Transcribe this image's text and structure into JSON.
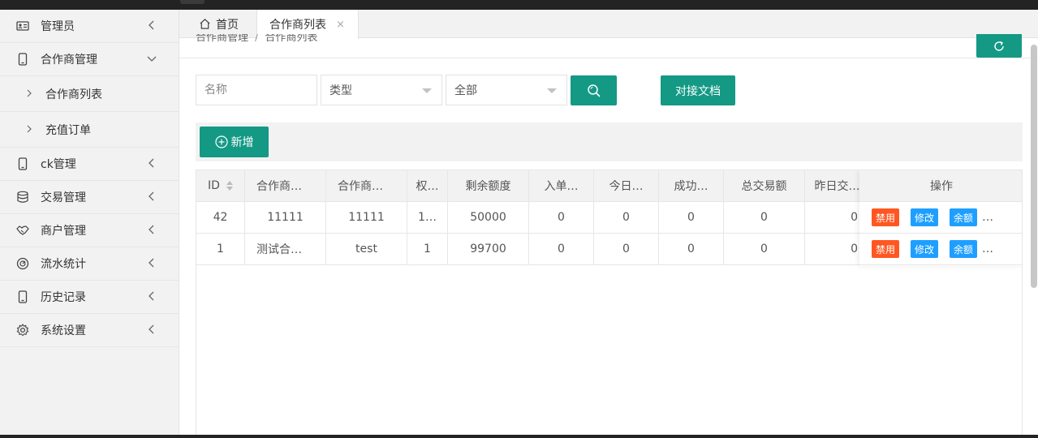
{
  "sidebar": {
    "items": [
      {
        "label": "管理员",
        "icon": "id-card-icon"
      },
      {
        "label": "合作商管理",
        "icon": "phone-icon",
        "expanded": true
      },
      {
        "label": "ck管理",
        "icon": "phone-icon"
      },
      {
        "label": "交易管理",
        "icon": "database-icon"
      },
      {
        "label": "商户管理",
        "icon": "handshake-icon"
      },
      {
        "label": "流水统计",
        "icon": "dashboard-icon"
      },
      {
        "label": "历史记录",
        "icon": "phone-icon"
      },
      {
        "label": "系统设置",
        "icon": "gear-icon"
      }
    ],
    "subitems": [
      {
        "label": "合作商列表"
      },
      {
        "label": "充值订单"
      }
    ]
  },
  "tabs": {
    "home": "首页",
    "active": "合作商列表",
    "close": "×"
  },
  "breadcrumb": {
    "parent": "合作商管理",
    "sep": "/",
    "current": "合作商列表"
  },
  "search": {
    "name_placeholder": "名称",
    "type_value": "类型",
    "status_value": "全部",
    "doc_button": "对接文档"
  },
  "toolbar": {
    "add_label": "新增"
  },
  "table": {
    "headers": [
      "ID",
      "合作商…",
      "合作商…",
      "权…",
      "剩余额度",
      "入单…",
      "今日…",
      "成功…",
      "总交易额",
      "昨日交…"
    ],
    "ops_header": "操作",
    "rows": [
      {
        "cells": [
          "42",
          "11111",
          "11111",
          "1…",
          "50000",
          "0",
          "0",
          "0",
          "0",
          "0"
        ]
      },
      {
        "cells": [
          "1",
          "测试合…",
          "test",
          "1",
          "99700",
          "0",
          "0",
          "0",
          "0",
          "0"
        ]
      }
    ],
    "ops": {
      "disable": "禁用",
      "edit": "修改",
      "balance": "余额",
      "more": "…"
    }
  },
  "colors": {
    "accent": "#149985",
    "danger": "#ff5722",
    "info": "#1e9fff"
  }
}
